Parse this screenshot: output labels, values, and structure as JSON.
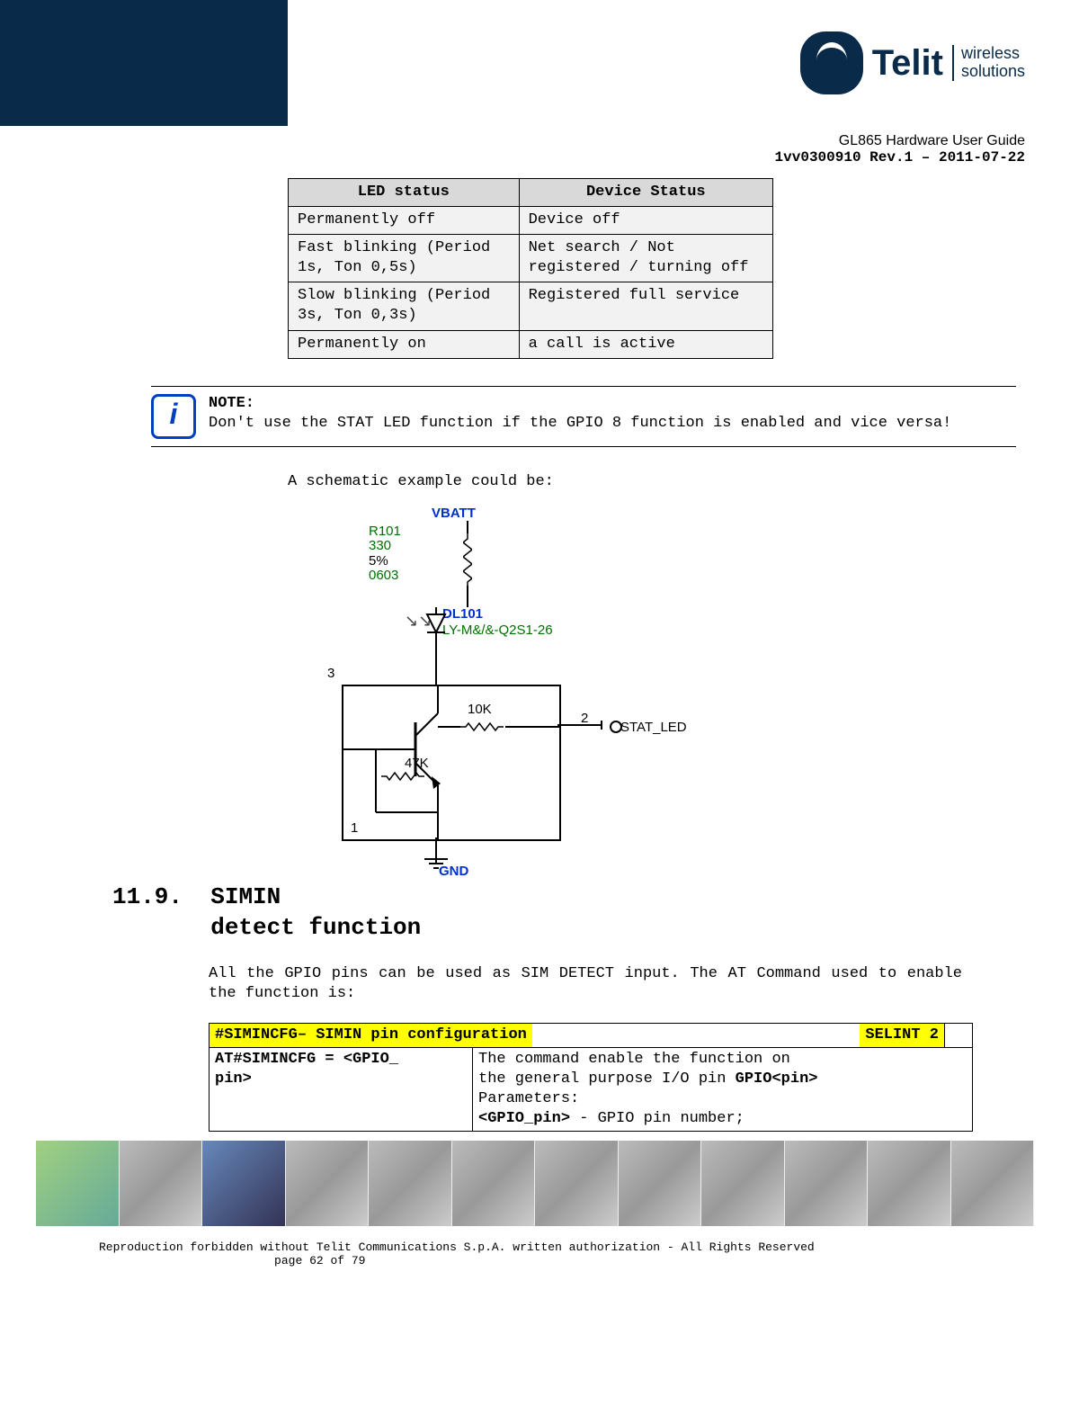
{
  "header": {
    "logo_main": "Telit",
    "logo_sub1": "wireless",
    "logo_sub2": "solutions",
    "doc_title": "GL865 Hardware User Guide",
    "doc_rev": "1vv0300910 Rev.1 – 2011-07-22"
  },
  "led_table": {
    "col1": "LED status",
    "col2": "Device Status",
    "rows": [
      {
        "c1": "Permanently off",
        "c2": "Device off"
      },
      {
        "c1": "Fast blinking (Period 1s, Ton 0,5s)",
        "c2": "Net search / Not registered / turning off"
      },
      {
        "c1": "Slow blinking (Period 3s, Ton 0,3s)",
        "c2": "Registered full service"
      },
      {
        "c1": "Permanently on",
        "c2": "a call is active"
      }
    ]
  },
  "note": {
    "title": "NOTE:",
    "body": "Don't use the STAT LED function if the GPIO 8 function is enabled and vice versa!"
  },
  "schematic": {
    "intro": "A schematic example could be:",
    "vbatt": "VBATT",
    "r101": "R101",
    "r101_val": "330",
    "r101_tol": "5%",
    "r101_pkg": "0603",
    "dl101": "DL101",
    "dl101_part": "LY-M&/&-Q2S1-26",
    "pin3": "3",
    "pin2": "2",
    "pin1": "1",
    "r_10k": "10K",
    "r_47k": "47K",
    "stat_led": "STAT_LED",
    "gnd": "GND"
  },
  "section": {
    "num": "11.9.",
    "title1": "SIMIN",
    "title2": "detect function",
    "para": "All the GPIO pins can be used as SIM DETECT input. The AT Command used to enable the function is:"
  },
  "cmd_table": {
    "hdr_left": "#SIMINCFG– SIMIN pin configuration",
    "hdr_right": "SELINT 2",
    "row1_c1a": "AT#SIMINCFG = <GPIO_",
    "row1_c1b": "pin>",
    "row1_c2_l1": "The command enable the function on",
    "row1_c2_l2a": "the general purpose I/O pin ",
    "row1_c2_l2b": "GPIO<pin>",
    "row1_c2_l3": "Parameters:",
    "row1_c2_l4a": "<GPIO_pin>",
    "row1_c2_l4b": " - GPIO pin number;"
  },
  "footer": {
    "line1": "Reproduction forbidden without Telit Communications S.p.A. written authorization - All Rights Reserved",
    "line2_pre": "page ",
    "line2_num": "62 of 79"
  }
}
